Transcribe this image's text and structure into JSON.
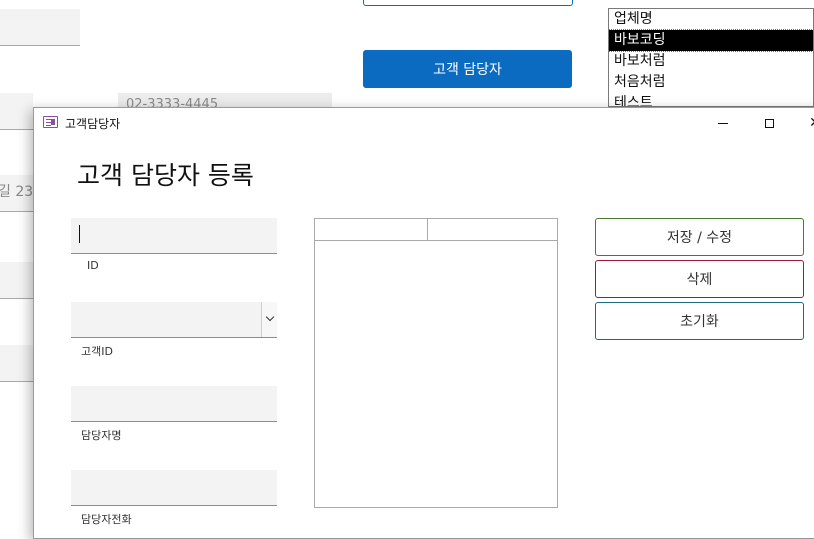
{
  "background_form": {
    "phone_value": "02-3333-4445",
    "address_fragment": "길 23",
    "manager_button_label": "고객 담당자",
    "company_list": [
      "업체명",
      "바보코딩",
      "바보처럼",
      "처음처럼",
      "테스트"
    ],
    "selected_company_index": 1,
    "colors": {
      "primary_blue": "#0b6bc0"
    }
  },
  "window": {
    "title": "고객담당자",
    "icon": "form-icon",
    "controls": [
      "minimize-icon",
      "maximize-icon",
      "close-icon"
    ]
  },
  "form": {
    "heading": "고객 담당자 등록",
    "fields": {
      "id": {
        "label": "ID",
        "value": ""
      },
      "customer_id": {
        "label": "고객ID",
        "value": ""
      },
      "manager_name": {
        "label": "담당자명",
        "value": ""
      },
      "manager_phone": {
        "label": "담당자전화",
        "value": ""
      }
    },
    "buttons": {
      "save": "저장 / 수정",
      "delete": "삭제",
      "reset": "초기화"
    },
    "colors": {
      "save_border": "#4a7a2a",
      "delete_border": "#9a1c3a",
      "reset_border": "#1c6a7a"
    }
  }
}
